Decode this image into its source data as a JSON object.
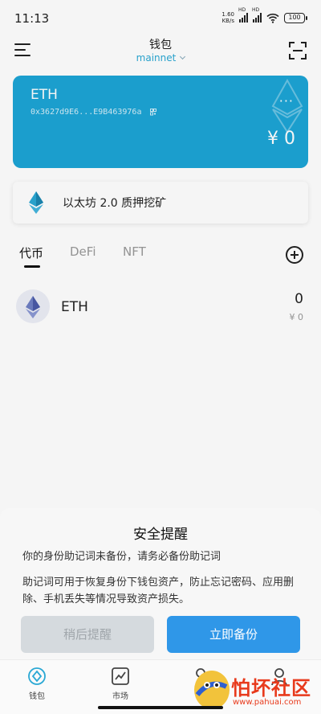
{
  "status_bar": {
    "time": "11:13",
    "net_speed": "1.60",
    "net_unit": "KB/s",
    "battery": "100",
    "signal_label": "HD"
  },
  "header": {
    "title": "钱包",
    "network": "mainnet"
  },
  "wallet_card": {
    "name": "ETH",
    "address": "0x3627d9E6...E9B463976a",
    "more_label": "···",
    "balance": "¥ 0",
    "color": "#1da5d6"
  },
  "staking_banner": {
    "label": "以太坊 2.0 质押挖矿"
  },
  "asset_tabs": [
    {
      "label": "代币",
      "active": true
    },
    {
      "label": "DeFi",
      "active": false
    },
    {
      "label": "NFT",
      "active": false
    }
  ],
  "assets": [
    {
      "symbol": "ETH",
      "amount": "0",
      "value": "¥ 0",
      "icon": "ethereum-icon"
    }
  ],
  "backup_sheet": {
    "title": "安全提醒",
    "warning": "你的身份助记词未备份，请务必备份助记词",
    "description": "助记词可用于恢复身份下钱包资产，防止忘记密码、应用删除、手机丢失等情况导致资产损失。",
    "remind_later": "稍后提醒",
    "backup_now": "立即备份",
    "primary_color": "#2f97e8"
  },
  "bottom_nav": [
    {
      "label": "钱包",
      "icon": "wallet-icon"
    },
    {
      "label": "市场",
      "icon": "chart-icon"
    },
    {
      "label": "",
      "icon": "discover-icon"
    },
    {
      "label": "",
      "icon": "profile-icon"
    }
  ],
  "site_watermark": {
    "text": "怕坏社区",
    "url": "www.pahuai.com"
  }
}
